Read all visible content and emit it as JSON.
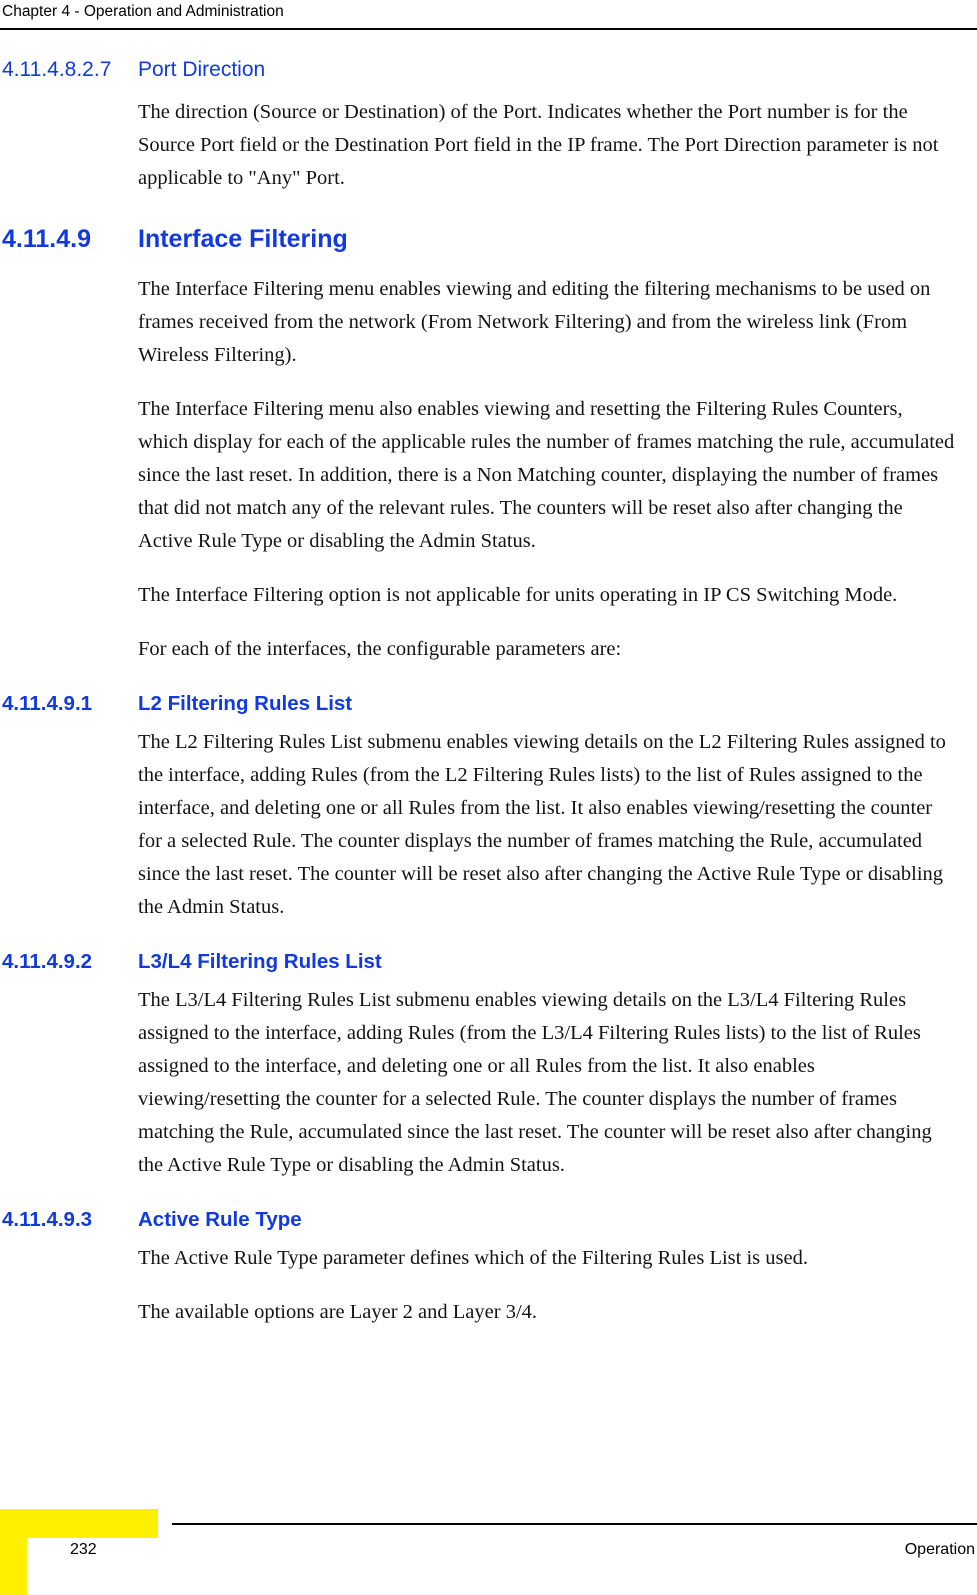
{
  "header": {
    "title": "Chapter 4 - Operation and Administration"
  },
  "colors": {
    "heading_blue": "#1039e0",
    "corner_yellow": "#fff000",
    "body_text": "#131313"
  },
  "sections": [
    {
      "number": "4.11.4.8.2.7",
      "title": "Port Direction",
      "level": "l5",
      "paragraphs": [
        "The direction (Source or Destination) of the Port. Indicates whether the Port number is for the Source Port field or the Destination Port field in the IP frame. The Port Direction parameter is not applicable to \"Any\" Port."
      ]
    },
    {
      "number": "4.11.4.9",
      "title": "Interface Filtering",
      "level": "l3",
      "paragraphs": [
        "The Interface Filtering menu enables viewing and editing the filtering mechanisms to be used on frames received from the network (From Network Filtering) and from the wireless link (From Wireless Filtering).",
        "The Interface Filtering menu also enables viewing and resetting the Filtering Rules Counters, which display for each of the applicable rules the number of frames matching the rule, accumulated since the last reset. In addition, there is a Non Matching counter, displaying the number of frames that did not match any of the relevant rules. The counters will be reset also after changing the Active Rule Type or disabling the Admin Status.",
        "The Interface Filtering option is not applicable for units operating in IP CS Switching Mode.",
        "For each of the interfaces, the configurable parameters are:"
      ]
    },
    {
      "number": "4.11.4.9.1",
      "title": "L2 Filtering Rules List",
      "level": "l4",
      "paragraphs": [
        "The L2 Filtering Rules List submenu enables viewing details on the L2 Filtering Rules assigned to the interface, adding Rules (from the L2 Filtering Rules lists) to the list of Rules assigned to the interface, and deleting one or all Rules from the list. It also enables viewing/resetting the counter for a selected Rule. The counter displays the number of frames matching the Rule, accumulated since the last reset. The counter will be reset also after changing the Active Rule Type or disabling the Admin Status."
      ]
    },
    {
      "number": "4.11.4.9.2",
      "title": "L3/L4 Filtering Rules List",
      "level": "l4",
      "paragraphs": [
        "The L3/L4 Filtering Rules List submenu enables viewing details on the L3/L4 Filtering Rules assigned to the interface, adding Rules (from the L3/L4 Filtering Rules lists) to the list of Rules assigned to the interface, and deleting one or all Rules from the list. It also enables viewing/resetting the counter for a selected Rule. The counter displays the number of frames matching the Rule, accumulated since the last reset. The counter will be reset also after changing the Active Rule Type or disabling the Admin Status."
      ]
    },
    {
      "number": "4.11.4.9.3",
      "title": "Active Rule Type",
      "level": "l4",
      "paragraphs": [
        "The Active Rule Type parameter defines which of the Filtering Rules List is used.",
        "The available options are Layer 2 and Layer 3/4."
      ]
    }
  ],
  "footer": {
    "page_number": "232",
    "section_label": "Operation"
  }
}
